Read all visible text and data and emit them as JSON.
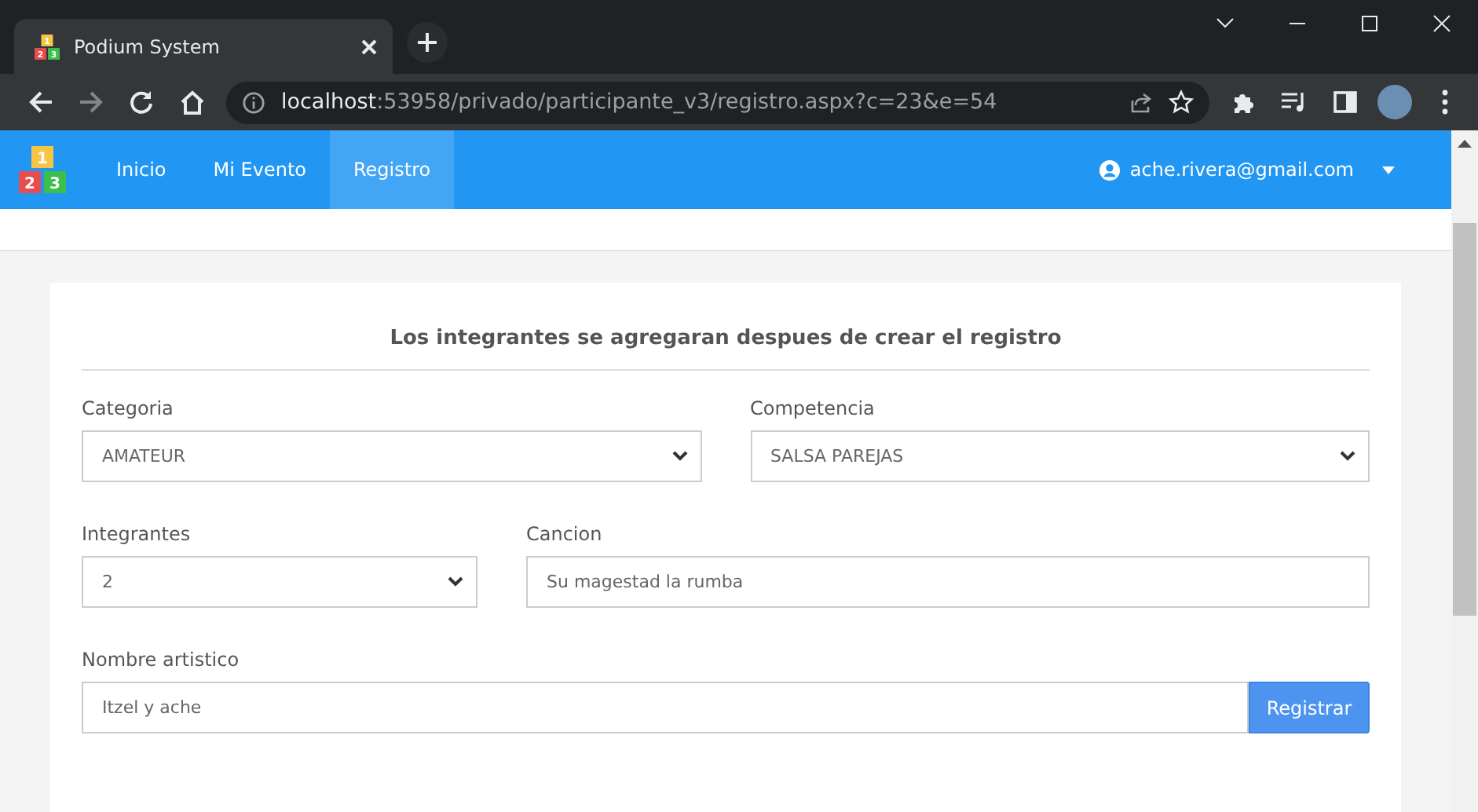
{
  "browser": {
    "favicon_digits": [
      "1",
      "2",
      "3"
    ],
    "tab_title": "Podium System",
    "url_host": "localhost",
    "url_rest": ":53958/privado/participante_v3/registro.aspx?c=23&e=54"
  },
  "navbar": {
    "logo_digits": [
      "1",
      "2",
      "3"
    ],
    "items": [
      {
        "label": "Inicio",
        "selected": false
      },
      {
        "label": "Mi Evento",
        "selected": false
      },
      {
        "label": "Registro",
        "selected": true
      }
    ],
    "user_email": "ache.rivera@gmail.com"
  },
  "form": {
    "heading": "Los integrantes se agregaran despues de crear el registro",
    "rows": [
      [
        {
          "kind": "select",
          "label": "Categoria",
          "value": "AMATEUR"
        },
        {
          "kind": "select",
          "label": "Competencia",
          "value": "SALSA PAREJAS"
        }
      ],
      [
        {
          "kind": "select",
          "label": "Integrantes",
          "value": "2"
        },
        {
          "kind": "input",
          "label": "Cancion",
          "value": "Su magestad la rumba"
        }
      ],
      [
        {
          "kind": "input_button",
          "label": "Nombre artistico",
          "value": "Itzel y ache",
          "button": "Registrar"
        }
      ]
    ]
  }
}
